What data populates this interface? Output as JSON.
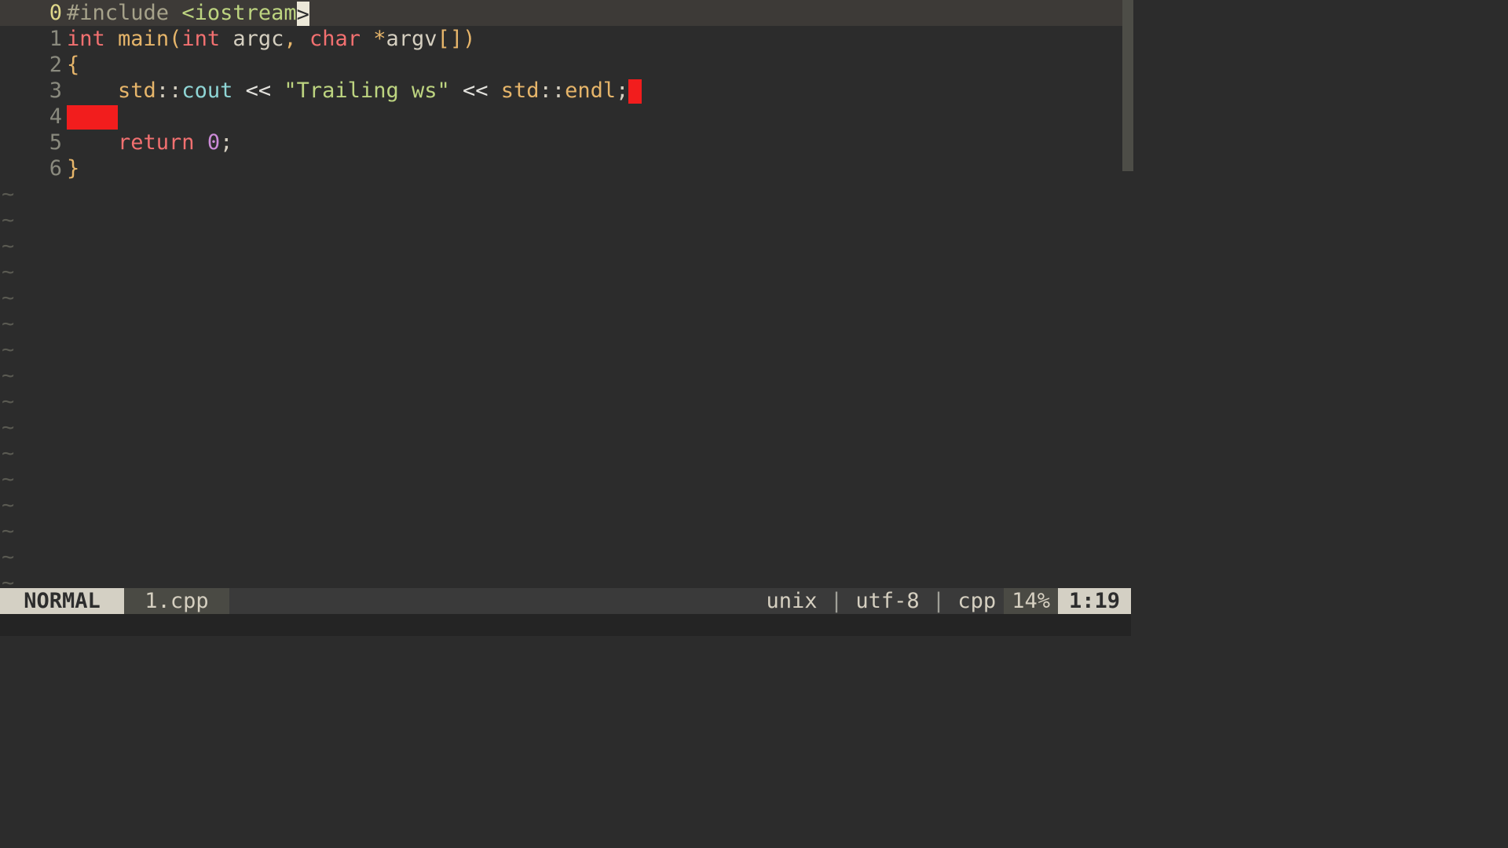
{
  "gutter": {
    "current": "0",
    "rel": [
      "1",
      "2",
      "3",
      "4",
      "5",
      "6"
    ]
  },
  "code": {
    "l0": {
      "pp": "#include ",
      "lt": "<",
      "header": "iostream",
      "gt_cursor": ">"
    },
    "l1": {
      "kw_int": "int",
      "sp1": " ",
      "main": "main",
      "lpar": "(",
      "kw_int2": "int",
      "sp2": " ",
      "argc": "argc",
      "comma": ",",
      "sp3": " ",
      "kw_char": "char",
      "sp4": " ",
      "star": "*",
      "argv": "argv",
      "lbrack": "[",
      "rbrack": "]",
      "rpar": ")"
    },
    "l2": {
      "brace": "{"
    },
    "l3": {
      "indent": "    ",
      "std1": "std",
      "cc1": "::",
      "cout": "cout",
      "sp1": " ",
      "lsh1": "<<",
      "sp2": " ",
      "str": "\"Trailing ws\"",
      "sp3": " ",
      "lsh2": "<<",
      "sp4": " ",
      "std2": "std",
      "cc2": "::",
      "endl": "endl",
      "semi": ";"
    },
    "l4": {
      "ws_chars": 4
    },
    "l5": {
      "indent": "    ",
      "ret": "return",
      "sp": " ",
      "zero": "0",
      "semi": ";"
    },
    "l6": {
      "brace": "}"
    }
  },
  "tilde_char": "~",
  "tilde_rows": 16,
  "status": {
    "mode": " NORMAL ",
    "filename": " 1.cpp ",
    "fileformat": "unix",
    "encoding": "utf-8",
    "filetype": "cpp",
    "percent": "14%",
    "position": "1:19",
    "sep": " | "
  }
}
